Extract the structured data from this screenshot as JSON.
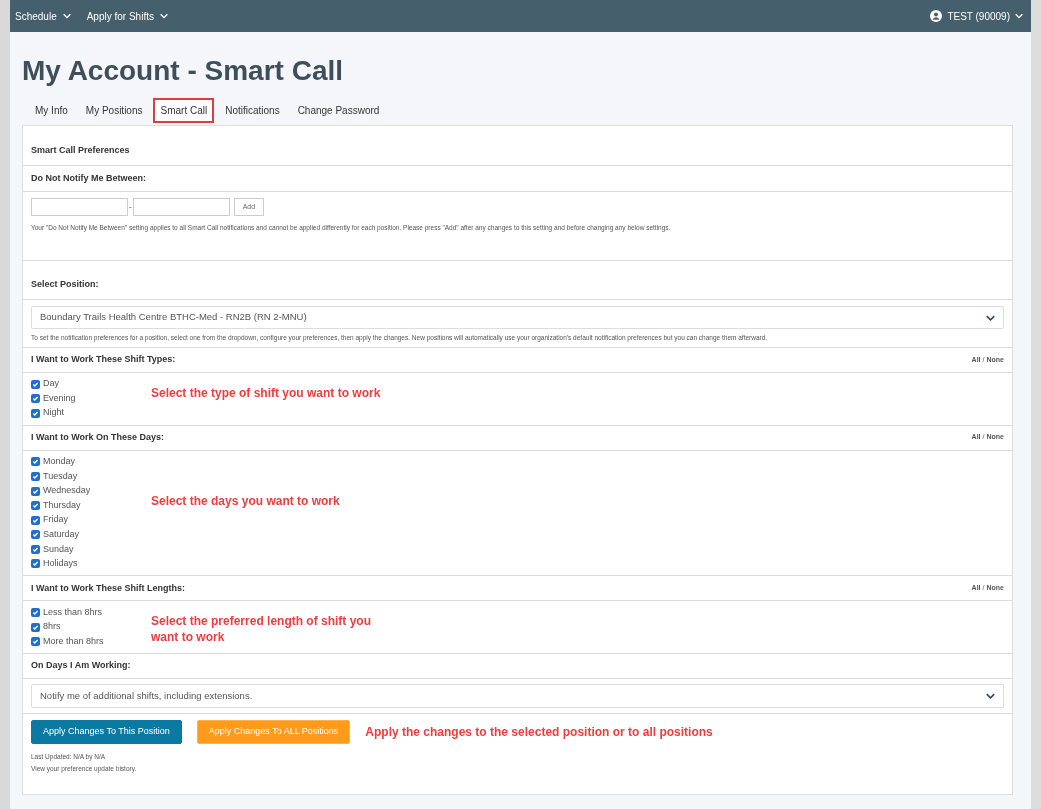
{
  "nav": {
    "menus": [
      {
        "label": "Schedule"
      },
      {
        "label": "Apply for Shifts"
      }
    ],
    "user": "TEST (90009)"
  },
  "title": "My Account - Smart Call",
  "tabs": [
    {
      "label": "My Info",
      "selected": false
    },
    {
      "label": "My Positions",
      "selected": false
    },
    {
      "label": "Smart Call",
      "selected": true
    },
    {
      "label": "Notifications",
      "selected": false
    },
    {
      "label": "Change Password",
      "selected": false
    }
  ],
  "preferences_heading": "Smart Call Preferences",
  "quiet_hours": {
    "heading": "Do Not Notify Me Between:",
    "separator": "-",
    "add_button": "Add",
    "note": "Your \"Do Not Notify Me Between\" setting applies to all Smart Call notifications and cannot be applied differently for each position. Please press \"Add\" after any changes to this setting and before changing any below settings."
  },
  "position": {
    "heading": "Select Position:",
    "value": "Boundary Trails Health Centre BTHC-Med - RN2B (RN 2-MNU)",
    "note": "To set the notification preferences for a position, select one from the dropdown, configure your preferences, then apply the changes. New positions will automatically use your organization's default notification preferences but you can change them afterward."
  },
  "groups": [
    {
      "heading": "I Want to Work These Shift Types:",
      "all": "All",
      "slash": "/",
      "none": "None",
      "annotation": "Select the type of shift you want to work",
      "options": [
        {
          "label": "Day",
          "checked": true
        },
        {
          "label": "Evening",
          "checked": true
        },
        {
          "label": "Night",
          "checked": true
        }
      ]
    },
    {
      "heading": "I Want to Work On These Days:",
      "all": "All",
      "slash": "/",
      "none": "None",
      "annotation": "Select the days you want to work",
      "options": [
        {
          "label": "Monday",
          "checked": true
        },
        {
          "label": "Tuesday",
          "checked": true
        },
        {
          "label": "Wednesday",
          "checked": true
        },
        {
          "label": "Thursday",
          "checked": true
        },
        {
          "label": "Friday",
          "checked": true
        },
        {
          "label": "Saturday",
          "checked": true
        },
        {
          "label": "Sunday",
          "checked": true
        },
        {
          "label": "Holidays",
          "checked": true
        }
      ]
    },
    {
      "heading": "I Want to Work These Shift Lengths:",
      "all": "All",
      "slash": "/",
      "none": "None",
      "annotation": "Select the preferred length of shift  you want to work",
      "options": [
        {
          "label": "Less than 8hrs",
          "checked": true
        },
        {
          "label": "8hrs",
          "checked": true
        },
        {
          "label": "More than 8hrs",
          "checked": true
        }
      ]
    }
  ],
  "working_days": {
    "heading": "On Days I Am Working:",
    "value": "Notify me of additional shifts, including extensions."
  },
  "buttons": [
    {
      "label": "Apply Changes To This Position",
      "kind": "primary"
    },
    {
      "label": "Apply Changes To ALL Positions",
      "kind": "warning"
    }
  ],
  "buttons_annotation": "Apply the changes to the selected position or to all positions",
  "last_updated": "Last Updated: N/A by N/A",
  "history_link": "View your preference update history."
}
